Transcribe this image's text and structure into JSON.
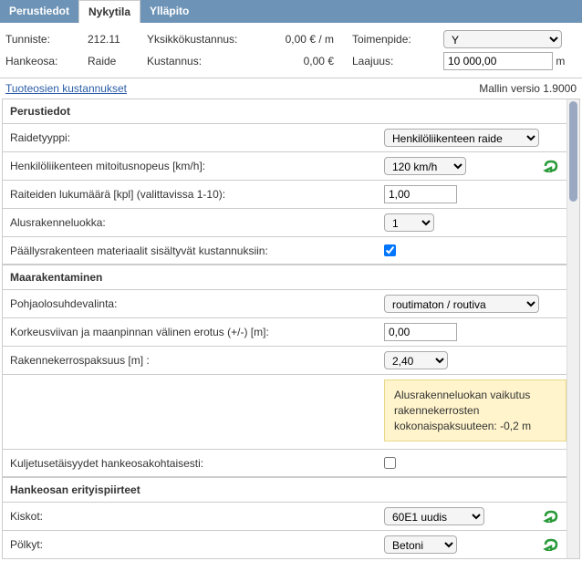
{
  "tabs": {
    "perustiedot": "Perustiedot",
    "nykytila": "Nykytila",
    "yllapito": "Ylläpito"
  },
  "info": {
    "tunniste_lbl": "Tunniste:",
    "tunniste_val": "212.11",
    "yksikko_lbl": "Yksikkökustannus:",
    "yksikko_val": "0,00 € / m",
    "toimenpide_lbl": "Toimenpide:",
    "toimenpide_val": "Y",
    "hankeosa_lbl": "Hankeosa:",
    "hankeosa_val": "Raide",
    "kustannus_lbl": "Kustannus:",
    "kustannus_val": "0,00 €",
    "laajuus_lbl": "Laajuus:",
    "laajuus_val": "10 000,00",
    "laajuus_unit": "m"
  },
  "link": "Tuoteosien kustannukset",
  "version": "Mallin versio 1.9000",
  "sections": {
    "perustiedot": "Perustiedot",
    "maarakentaminen": "Maarakentaminen",
    "erityis": "Hankeosan erityispiirteet"
  },
  "rows": {
    "raidetyyppi_lbl": "Raidetyyppi:",
    "raidetyyppi_val": "Henkilöliikenteen raide",
    "mitoitusnopeus_lbl": "Henkilöliikenteen mitoitusnopeus [km/h]:",
    "mitoitusnopeus_val": "120 km/h",
    "raiteiden_lbl": "Raiteiden lukumäärä [kpl] (valittavissa 1-10):",
    "raiteiden_val": "1,00",
    "alusrakenne_lbl": "Alusrakenneluokka:",
    "alusrakenne_val": "1",
    "paallys_lbl": "Päällysrakenteen materiaalit sisältyvät kustannuksiin:",
    "pohja_lbl": "Pohjaolosuhdevalinta:",
    "pohja_val": "routimaton / routiva",
    "korkeus_lbl": "Korkeusviivan ja maanpinnan välinen erotus (+/-) [m]:",
    "korkeus_val": "0,00",
    "rakenne_lbl": "Rakennekerrospaksuus [m] :",
    "rakenne_val": "2,40",
    "note": "Alusrakenneluokan vaikutus rakennekerrosten kokonaispaksuuteen: -0,2 m",
    "kuljetus_lbl": "Kuljetusetäisyydet hankeosakohtaisesti:",
    "kiskot_lbl": "Kiskot:",
    "kiskot_val": "60E1 uudis",
    "polkyt_lbl": "Pölkyt:",
    "polkyt_val": "Betoni"
  }
}
